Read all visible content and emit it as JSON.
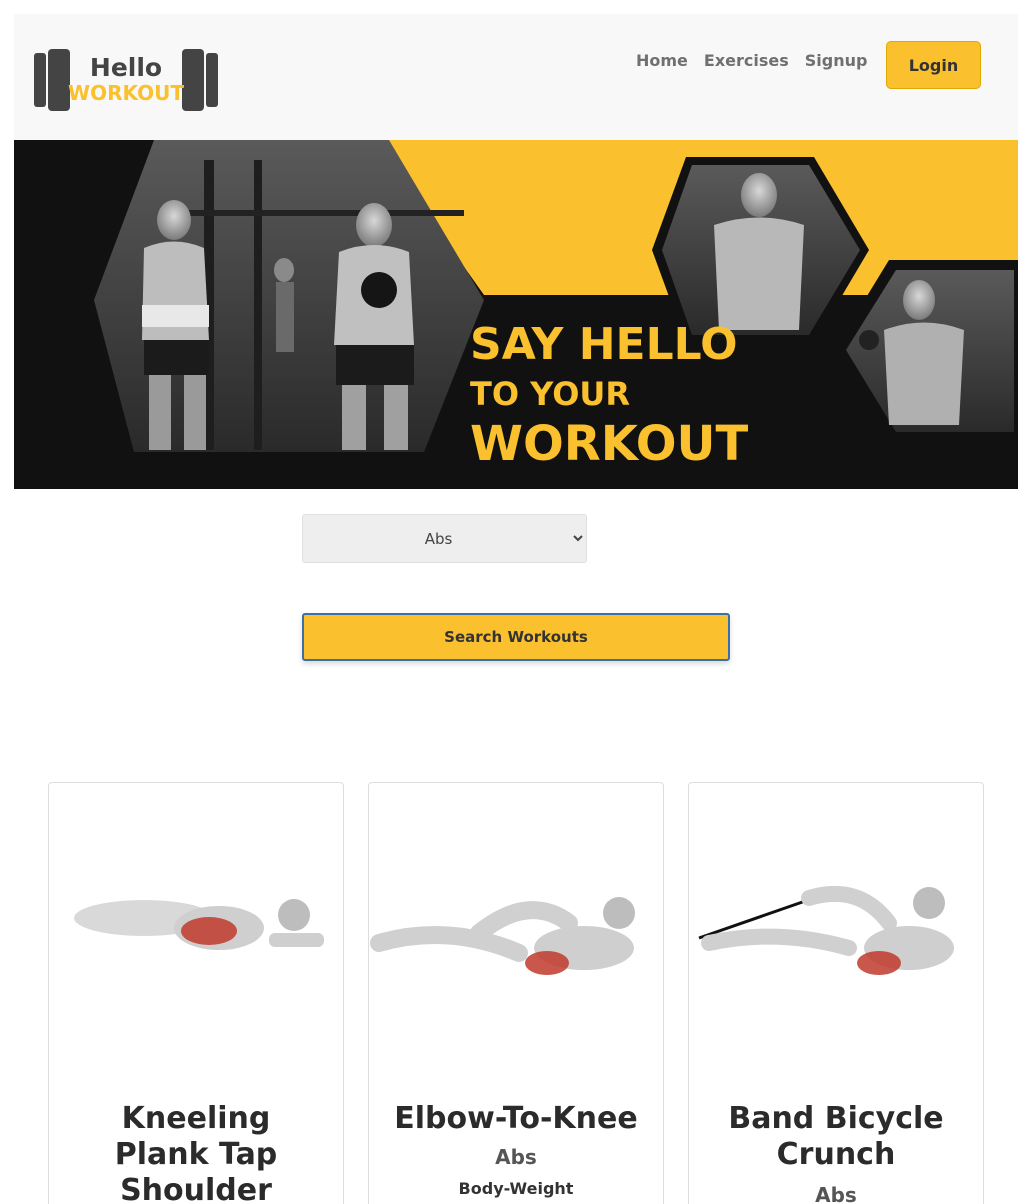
{
  "brand": {
    "logo_line1": "Hello",
    "logo_line2": "WORKOUT",
    "accent_color": "#fbc02d",
    "dark_color": "#2f2f2f"
  },
  "nav": {
    "items": [
      {
        "label": "Home"
      },
      {
        "label": "Exercises"
      },
      {
        "label": "Signup"
      }
    ],
    "login_label": "Login"
  },
  "hero": {
    "headline_line1": "SAY HELLO",
    "headline_line2": "TO YOUR",
    "headline_line3": "WORKOUT"
  },
  "search": {
    "selected_body_part": "Abs",
    "button_label": "Search Workouts"
  },
  "cards": [
    {
      "title_lines": [
        "Kneeling",
        "Plank Tap",
        "Shoulder"
      ],
      "body_part": "",
      "equipment": ""
    },
    {
      "title_lines": [
        "Elbow-To-Knee"
      ],
      "body_part": "Abs",
      "equipment": "Body-Weight"
    },
    {
      "title_lines": [
        "Band Bicycle",
        "Crunch"
      ],
      "body_part": "Abs",
      "equipment": ""
    }
  ]
}
